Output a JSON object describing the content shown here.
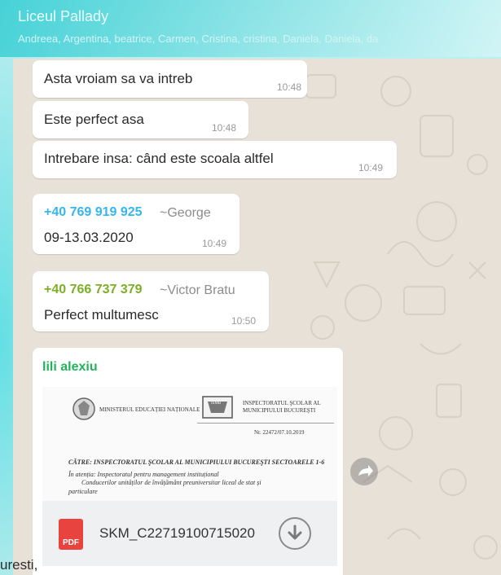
{
  "header": {
    "group_name": "Liceul Pallady",
    "members": "Andreea, Argentina, beatrice, Carmen, Cristina, cristina, Daniela, Daniela, da"
  },
  "messages": [
    {
      "text": "Asta vroiam sa va intreb",
      "time": "10:48"
    },
    {
      "text": "Este perfect asa",
      "time": "10:48"
    },
    {
      "text": "Intrebare insa: când este scoala altfel",
      "time": "10:49"
    },
    {
      "phone": "+40 769 919 925",
      "alias": "~George",
      "text": "09-13.03.2020",
      "time": "10:49"
    },
    {
      "phone": "+40 766 737 379",
      "alias": "~Victor Bratu",
      "text": "Perfect multumesc",
      "time": "10:50"
    }
  ],
  "document_message": {
    "sender": "lili alexiu",
    "preview": {
      "ministry": "MINISTERUL EDUCAȚIEI NAȚIONALE",
      "isj": "ISMB",
      "inspectorate": "INSPECTORATUL ŞCOLAR AL MUNICIPIULUI BUCUREŞTI",
      "reg_no": "Nr. 22472/07.10.2019",
      "to_line": "CĂTRE: INSPECTORATUL ŞCOLAR AL MUNICIPIULUI BUCUREŞTI SECTOARELE 1-6",
      "attn_line": "În atenția: Inspectoratul pentru management instituțional",
      "directors_line": "Conducerilor unităților de învățământ preuniversitar liceal de stat și",
      "private_line": "particulare"
    },
    "file_type": "PDF",
    "file_name": "SKM_C22719100715020"
  },
  "footer_fragment": "uresti,",
  "colors": {
    "george_phone": "#34b7f1",
    "victor_phone": "#7bb024",
    "sender_name": "#22b35a",
    "pdf_red": "#e8433e"
  },
  "icons": [
    "forward-icon",
    "download-icon",
    "pdf-file-icon"
  ]
}
